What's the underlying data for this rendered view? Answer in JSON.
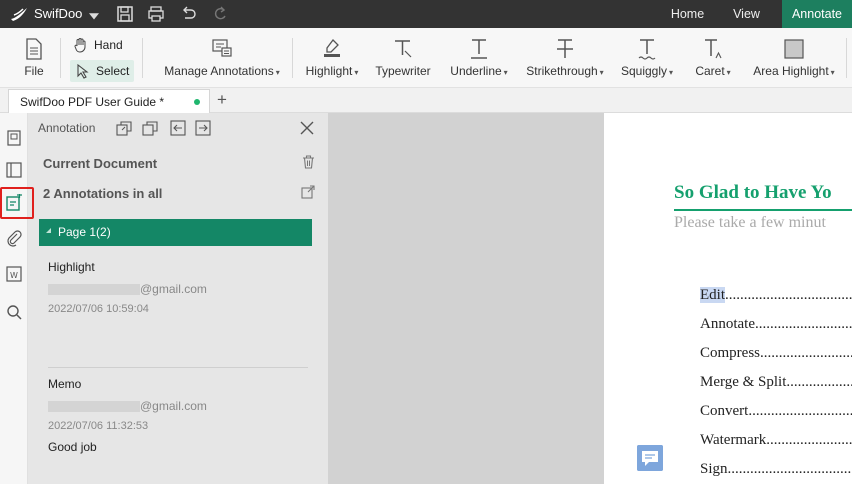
{
  "app": {
    "name": "SwifDoo"
  },
  "nav": {
    "home": "Home",
    "view": "View",
    "annotate": "Annotate"
  },
  "ribbon": {
    "file": "File",
    "hand": "Hand",
    "select": "Select",
    "manage": "Manage Annotations",
    "highlight": "Highlight",
    "typewriter": "Typewriter",
    "underline": "Underline",
    "strikethrough": "Strikethrough",
    "squiggly": "Squiggly",
    "caret": "Caret",
    "area_highlight": "Area Highlight"
  },
  "tab": {
    "title": "SwifDoo PDF User Guide *",
    "new": "+"
  },
  "panel": {
    "title": "Annotation",
    "current_document": "Current Document",
    "count": "2 Annotations in all",
    "page_label": "Page 1(2)",
    "annotations": [
      {
        "type": "Highlight",
        "email_suffix": "@gmail.com",
        "date": "2022/07/06 10:59:04",
        "body": ""
      },
      {
        "type": "Memo",
        "email_suffix": "@gmail.com",
        "date": "2022/07/06 11:32:53",
        "body": "Good job"
      }
    ]
  },
  "document": {
    "heading": "So Glad to Have Yo",
    "subtitle": "Please take a few minut",
    "toc": [
      {
        "mark": "Edit",
        "rest": "...................................."
      },
      {
        "mark": "",
        "rest": "Annotate............................"
      },
      {
        "mark": "",
        "rest": "Compress..........................."
      },
      {
        "mark": "",
        "rest": "Merge & Split......................"
      },
      {
        "mark": "",
        "rest": "Convert..............................."
      },
      {
        "mark": "",
        "rest": "Watermark.........................."
      },
      {
        "mark": "",
        "rest": "Sign...................................."
      }
    ]
  },
  "colors": {
    "accent": "#148766",
    "titlebar": "#333333",
    "heading": "#15a06e",
    "highlight": "#c9d8f2"
  }
}
